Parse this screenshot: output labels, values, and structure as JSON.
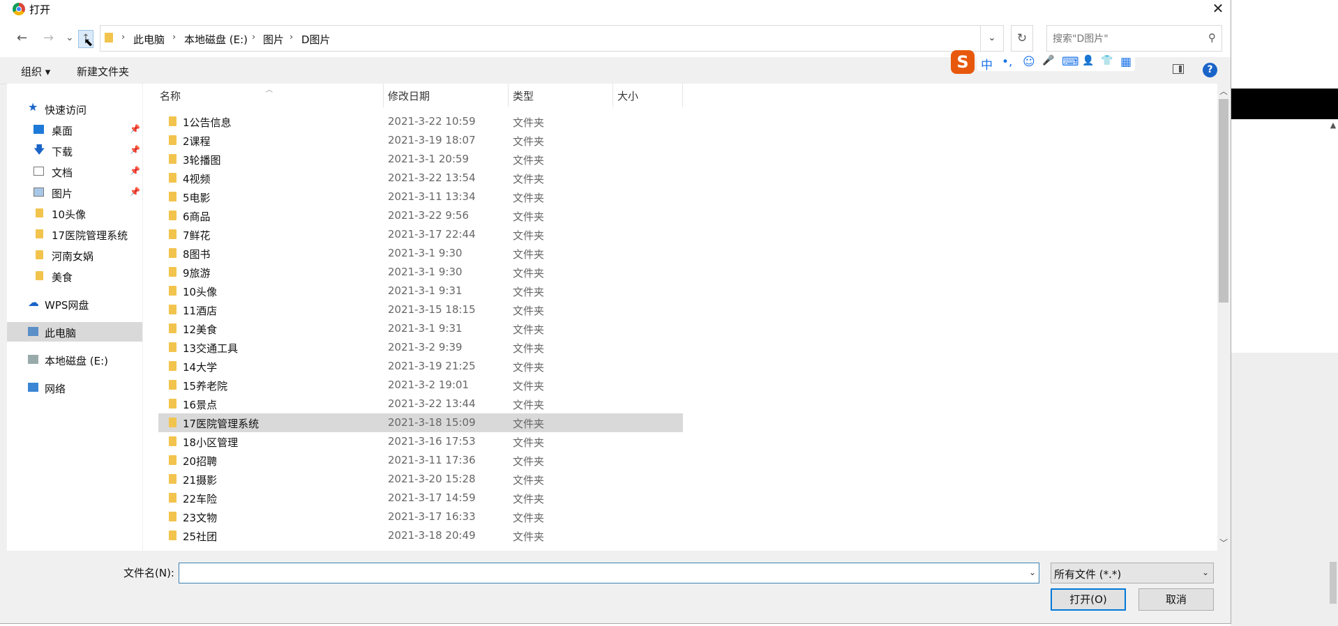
{
  "window": {
    "title": "打开",
    "close": "✕"
  },
  "nav": {
    "back": "←",
    "forward": "→",
    "recent": "⌄",
    "up": "↑"
  },
  "breadcrumb": [
    "此电脑",
    "本地磁盘 (E:)",
    "图片",
    "D图片"
  ],
  "search": {
    "placeholder": "搜索\"D图片\"",
    "icon": "search-icon"
  },
  "toolbar": {
    "organize": "组织 ▾",
    "new_folder": "新建文件夹"
  },
  "ime": {
    "logo": "S",
    "items": [
      "中",
      "•,",
      "☺",
      "🎤",
      "⌨",
      "👤",
      "👕",
      "▦"
    ]
  },
  "sidebar": [
    {
      "name": "快速访问",
      "icon": "star",
      "pinned": false,
      "level": 0
    },
    {
      "name": "桌面",
      "icon": "desk",
      "pinned": true,
      "level": 1
    },
    {
      "name": "下载",
      "icon": "down",
      "pinned": true,
      "level": 1
    },
    {
      "name": "文档",
      "icon": "doc",
      "pinned": true,
      "level": 1
    },
    {
      "name": "图片",
      "icon": "pic",
      "pinned": true,
      "level": 1
    },
    {
      "name": "10头像",
      "icon": "folder",
      "pinned": false,
      "level": 1
    },
    {
      "name": "17医院管理系统",
      "icon": "folder",
      "pinned": false,
      "level": 1
    },
    {
      "name": "河南女娲",
      "icon": "folder",
      "pinned": false,
      "level": 1
    },
    {
      "name": "美食",
      "icon": "folder",
      "pinned": false,
      "level": 1
    },
    {
      "name": "WPS网盘",
      "icon": "cloud",
      "pinned": false,
      "level": 0
    },
    {
      "name": "此电脑",
      "icon": "pc",
      "pinned": false,
      "level": 0,
      "selected": true
    },
    {
      "name": "本地磁盘 (E:)",
      "icon": "disk",
      "pinned": false,
      "level": 0
    },
    {
      "name": "网络",
      "icon": "net",
      "pinned": false,
      "level": 0
    }
  ],
  "columns": {
    "name": "名称",
    "date": "修改日期",
    "type": "类型",
    "size": "大小"
  },
  "files": [
    {
      "name": "1公告信息",
      "date": "2021-3-22 10:59",
      "type": "文件夹"
    },
    {
      "name": "2课程",
      "date": "2021-3-19 18:07",
      "type": "文件夹"
    },
    {
      "name": "3轮播图",
      "date": "2021-3-1 20:59",
      "type": "文件夹"
    },
    {
      "name": "4视频",
      "date": "2021-3-22 13:54",
      "type": "文件夹"
    },
    {
      "name": "5电影",
      "date": "2021-3-11 13:34",
      "type": "文件夹"
    },
    {
      "name": "6商品",
      "date": "2021-3-22 9:56",
      "type": "文件夹"
    },
    {
      "name": "7鲜花",
      "date": "2021-3-17 22:44",
      "type": "文件夹"
    },
    {
      "name": "8图书",
      "date": "2021-3-1 9:30",
      "type": "文件夹"
    },
    {
      "name": "9旅游",
      "date": "2021-3-1 9:30",
      "type": "文件夹"
    },
    {
      "name": "10头像",
      "date": "2021-3-1 9:31",
      "type": "文件夹"
    },
    {
      "name": "11酒店",
      "date": "2021-3-15 18:15",
      "type": "文件夹"
    },
    {
      "name": "12美食",
      "date": "2021-3-1 9:31",
      "type": "文件夹"
    },
    {
      "name": "13交通工具",
      "date": "2021-3-2 9:39",
      "type": "文件夹"
    },
    {
      "name": "14大学",
      "date": "2021-3-19 21:25",
      "type": "文件夹"
    },
    {
      "name": "15养老院",
      "date": "2021-3-2 19:01",
      "type": "文件夹"
    },
    {
      "name": "16景点",
      "date": "2021-3-22 13:44",
      "type": "文件夹"
    },
    {
      "name": "17医院管理系统",
      "date": "2021-3-18 15:09",
      "type": "文件夹",
      "selected": true
    },
    {
      "name": "18小区管理",
      "date": "2021-3-16 17:53",
      "type": "文件夹"
    },
    {
      "name": "20招聘",
      "date": "2021-3-11 17:36",
      "type": "文件夹"
    },
    {
      "name": "21摄影",
      "date": "2021-3-20 15:28",
      "type": "文件夹"
    },
    {
      "name": "22车险",
      "date": "2021-3-17 14:59",
      "type": "文件夹"
    },
    {
      "name": "23文物",
      "date": "2021-3-17 16:33",
      "type": "文件夹"
    },
    {
      "name": "25社团",
      "date": "2021-3-18 20:49",
      "type": "文件夹"
    }
  ],
  "bottom": {
    "filename_label": "文件名(N):",
    "filename_value": "",
    "filetype": "所有文件 (*.*)",
    "open": "打开(O)",
    "cancel": "取消"
  }
}
